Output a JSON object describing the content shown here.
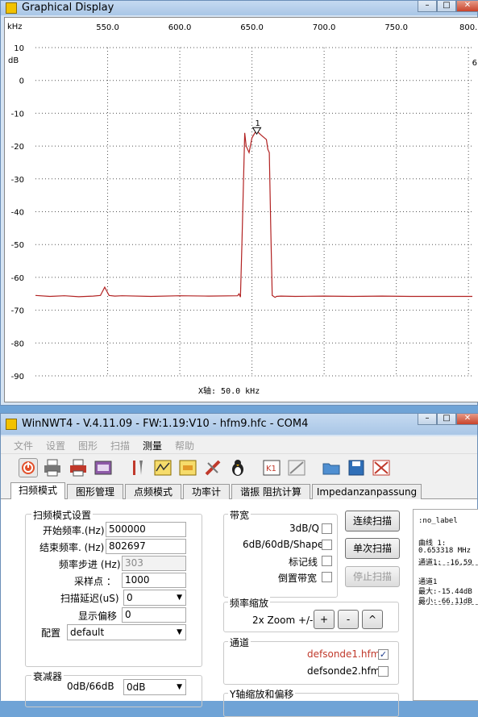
{
  "graph_window": {
    "title": "Graphical Display",
    "x_unit": "kHz",
    "y_unit": "dB",
    "x_ticks": [
      "550.0",
      "600.0",
      "650.0",
      "700.0",
      "750.0",
      "800."
    ],
    "y_ticks": [
      "10",
      "0",
      "-10",
      "-20",
      "-30",
      "-40",
      "-50",
      "-60",
      "-70",
      "-80",
      "-90"
    ],
    "marker_label": "1",
    "x_axis_note": "X轴: 50.0 kHz",
    "trace_color": "#b22222"
  },
  "chart_data": {
    "type": "line",
    "xlabel": "kHz",
    "ylabel": "dB",
    "xlim": [
      500.0,
      802.697
    ],
    "ylim": [
      -90,
      10
    ],
    "grid": true,
    "marker": {
      "label": "1",
      "x": 653.318,
      "y": -16.59
    },
    "series": [
      {
        "x": [
          500,
          510,
          520,
          530,
          540,
          545,
          548,
          551,
          555,
          560,
          580,
          600,
          620,
          640,
          641,
          642,
          643,
          645,
          646,
          648,
          650,
          652,
          653.3,
          656,
          660,
          661,
          662,
          663,
          664,
          666,
          667,
          670,
          680,
          700,
          720,
          740,
          760,
          780,
          800,
          802.7
        ],
        "y": [
          -65.5,
          -65.8,
          -65.6,
          -65.9,
          -65.7,
          -65.5,
          -63,
          -65.5,
          -65.7,
          -65.6,
          -65.8,
          -65.6,
          -65.7,
          -65.6,
          -65,
          -66,
          -50,
          -16,
          -20,
          -22,
          -17.5,
          -16,
          -15.4,
          -16.5,
          -18,
          -21,
          -22,
          -45,
          -65.5,
          -66.1,
          -65.8,
          -65.7,
          -65.8,
          -65.7,
          -65.8,
          -65.7,
          -65.8,
          -65.8,
          -65.8,
          -65.8
        ]
      }
    ]
  },
  "main_window": {
    "title": "WinNWT4 - V.4.11.09 - FW:1.19:V10 - hfm9.hfc - COM4",
    "menus": [
      "文件",
      "设置",
      "图形",
      "扫描",
      "测量",
      "帮助"
    ],
    "tabs": [
      "扫频模式",
      "图形管理",
      "点频模式",
      "功率计",
      "谐振 阻抗计算",
      "Impedanzanpassung"
    ],
    "settings_group": "扫频模式设置",
    "start_label": "开始频率.(Hz)",
    "start_value": "500000",
    "end_label": "结束频率. (Hz)",
    "end_value": "802697",
    "step_label": "频率步进 (Hz)",
    "step_value": "303",
    "points_label": "采样点 ：",
    "points_value": "1000",
    "delay_label": "扫描延迟(uS)",
    "delay_value": "0",
    "offset_label": "显示偏移",
    "offset_value": "0",
    "config_label": "配置",
    "config_value": "default",
    "attenuator_group": "衰减器",
    "atten_label": "0dB/66dB",
    "atten_value": "0dB",
    "bandwidth_group": "带宽",
    "bw_3db": "3dB/Q",
    "bw_shape": "6dB/60dB/Shape",
    "bw_marker": "标记线",
    "bw_inverted": "倒置带宽",
    "btn_continuous": "连续扫描",
    "btn_single": "单次扫描",
    "btn_stop": "停止扫描",
    "zoom_group": "频率缩放",
    "zoom_label": "2x Zoom +/-",
    "zoom_plus": "+",
    "zoom_minus": "-",
    "zoom_up": "^",
    "channel_group": "通道",
    "channel1": "defsonde1.hfm",
    "channel2": "defsonde2.hfm",
    "yaxis_group": "Y轴缩放和偏移",
    "info": {
      "l1": ":no_label",
      "l2": "曲线 1:",
      "l3": "0.653318 MHz",
      "l4": "通道1: -16.59",
      "l5": "通道1",
      "l6": "最大:-15.44dB",
      "l7": "最小:-66.11dB"
    }
  }
}
